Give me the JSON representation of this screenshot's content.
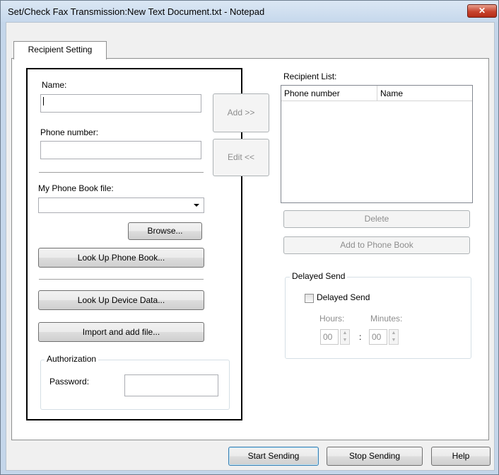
{
  "window": {
    "title": "Set/Check Fax Transmission:New Text Document.txt - Notepad",
    "close_glyph": "✕"
  },
  "tabs": [
    {
      "label": "Recipient Setting"
    }
  ],
  "left": {
    "name_label": "Name:",
    "name_value": "",
    "phone_label": "Phone number:",
    "phone_value": "",
    "phonebook_label": "My Phone Book file:",
    "phonebook_value": "",
    "browse_label": "Browse...",
    "lookup_phonebook_label": "Look Up Phone Book...",
    "lookup_device_label": "Look Up Device Data...",
    "import_label": "Import and add file...",
    "authorization_title": "Authorization",
    "password_label": "Password:",
    "password_value": ""
  },
  "middle": {
    "add_label": "Add >>",
    "edit_label": "Edit <<"
  },
  "right": {
    "recipient_list_label": "Recipient List:",
    "columns": [
      "Phone number",
      "Name"
    ],
    "delete_label": "Delete",
    "add_phonebook_label": "Add to Phone Book",
    "delayed_group_title": "Delayed Send",
    "delayed_checkbox_label": "Delayed Send",
    "delayed_checked": false,
    "hours_label": "Hours:",
    "minutes_label": "Minutes:",
    "hours_value": "00",
    "minutes_value": "00",
    "colon": ":"
  },
  "footer": {
    "start_label": "Start Sending",
    "stop_label": "Stop Sending",
    "help_label": "Help"
  }
}
